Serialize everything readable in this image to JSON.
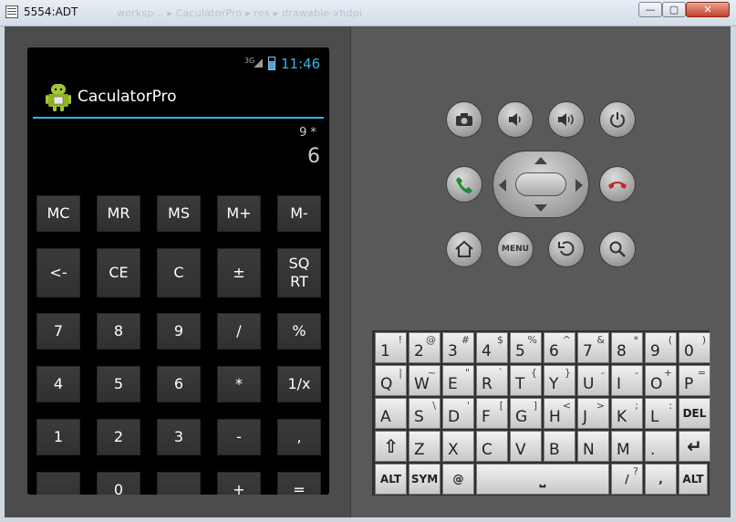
{
  "window": {
    "title": "5554:ADT",
    "ghost_title": "worksp... ▸ CaculatorPro ▸ res ▸ drawable-xhdpi",
    "min": "—",
    "max": "▢",
    "close": "✕"
  },
  "status": {
    "network": "3G",
    "time": "11:46"
  },
  "app": {
    "title": "CaculatorPro"
  },
  "display": {
    "expression": "9 *",
    "result": "6"
  },
  "calc_keys": [
    [
      "MC",
      "MR",
      "MS",
      "M+",
      "M-"
    ],
    [
      "<-",
      "CE",
      "C",
      "±",
      "SQ RT"
    ],
    [
      "7",
      "8",
      "9",
      "/",
      "%"
    ],
    [
      "4",
      "5",
      "6",
      "*",
      "1/x"
    ],
    [
      "1",
      "2",
      "3",
      "-",
      ","
    ],
    [
      "",
      "0",
      "",
      "+",
      "="
    ]
  ],
  "hardware_keys": {
    "row1": [
      "camera-icon",
      "volume-down-icon",
      "volume-up-icon",
      "power-icon"
    ],
    "row2": [
      "call-icon",
      "dpad",
      "end-call-icon"
    ],
    "row3": [
      "home-icon",
      "menu",
      "back-icon",
      "search-icon"
    ],
    "menu_label": "MENU"
  },
  "keyboard": {
    "row1": [
      [
        "1",
        "!"
      ],
      [
        "2",
        "@"
      ],
      [
        "3",
        "#"
      ],
      [
        "4",
        "$"
      ],
      [
        "5",
        "%"
      ],
      [
        "6",
        "^"
      ],
      [
        "7",
        "&"
      ],
      [
        "8",
        "*"
      ],
      [
        "9",
        "("
      ],
      [
        "0",
        ")"
      ]
    ],
    "row2": [
      [
        "Q",
        "|"
      ],
      [
        "W",
        "~"
      ],
      [
        "E",
        "\""
      ],
      [
        "R",
        "`"
      ],
      [
        "T",
        "{"
      ],
      [
        "Y",
        "}"
      ],
      [
        "U",
        "-"
      ],
      [
        "I",
        "-"
      ],
      [
        "O",
        "+"
      ],
      [
        "P",
        "="
      ]
    ],
    "row3": [
      [
        "A",
        ""
      ],
      [
        "S",
        "\\"
      ],
      [
        "D",
        "'"
      ],
      [
        "F",
        "["
      ],
      [
        "G",
        "]"
      ],
      [
        "H",
        "<"
      ],
      [
        "J",
        ">"
      ],
      [
        "K",
        ";"
      ],
      [
        "L",
        ":"
      ],
      [
        "DEL",
        ""
      ]
    ],
    "row4": [
      [
        "⇧",
        ""
      ],
      [
        "Z",
        ""
      ],
      [
        "X",
        ""
      ],
      [
        "C",
        ""
      ],
      [
        "V",
        ""
      ],
      [
        "B",
        ""
      ],
      [
        "N",
        ""
      ],
      [
        "M",
        ""
      ],
      [
        ".",
        ""
      ],
      [
        "↵",
        ""
      ]
    ],
    "row5": {
      "alt_left": "ALT",
      "sym": "SYM",
      "at": "@",
      "space": "⎵",
      "slash": "/",
      "question": "?",
      "comma": ",",
      "alt_right": "ALT"
    }
  },
  "colors": {
    "accent": "#33b5e5",
    "phone_bg": "#000000",
    "skin": "#595959"
  }
}
